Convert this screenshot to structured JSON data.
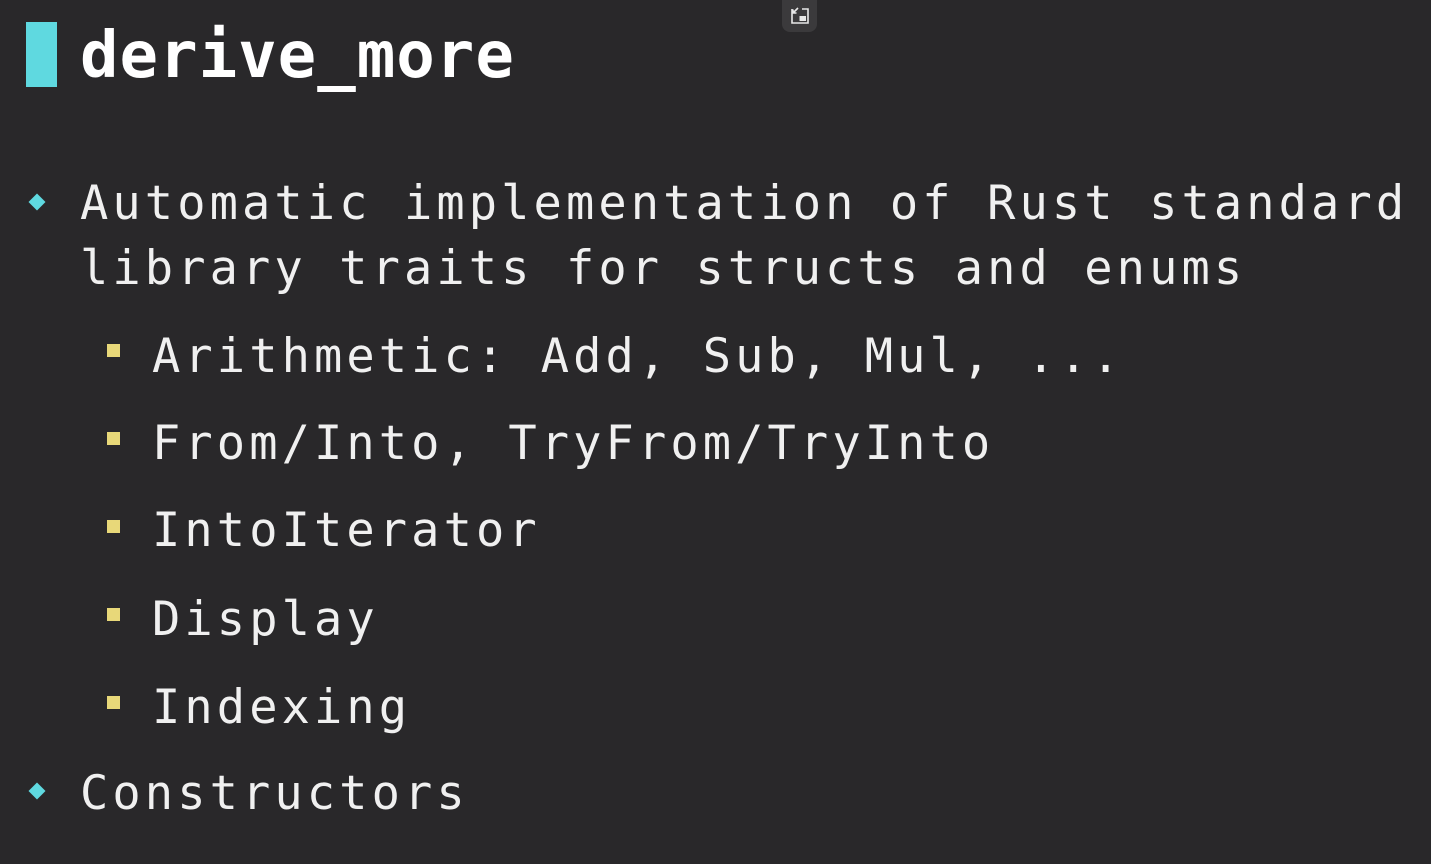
{
  "slide": {
    "title": "derive_more",
    "accent_color": "#5fd9e0",
    "sub_bullet_color": "#e8d879",
    "background": "#29282a"
  },
  "toolbar": {
    "pip_icon": "exit-picture-in-picture-icon"
  },
  "bullets": [
    {
      "line1": "Automatic implementation of Rust standard",
      "line2": "library traits for structs and enums",
      "children": [
        "Arithmetic: Add, Sub, Mul, ...",
        "From/Into, TryFrom/TryInto",
        "IntoIterator",
        "Display",
        "Indexing"
      ]
    },
    {
      "line1": "Constructors"
    }
  ]
}
